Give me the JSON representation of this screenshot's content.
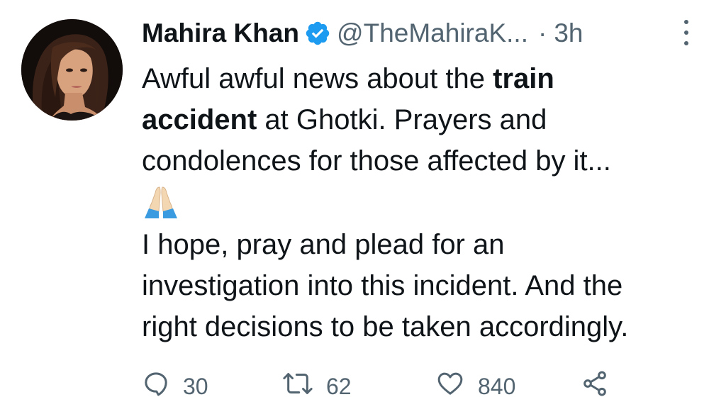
{
  "author": {
    "name": "Mahira Khan",
    "handle": "@TheMahiraK...",
    "separator": "·",
    "time": "3h"
  },
  "tweet": {
    "line1_pre": "Awful awful news about the ",
    "line1_bold": "train",
    "line2_bold": "accident",
    "line2_post": " at Ghotki. Prayers and",
    "line3": "condolences for those affected by it...",
    "line4": "I hope, pray and plead for an",
    "line5": "investigation into this incident. And the",
    "line6": "right decisions to be taken accordingly."
  },
  "actions": {
    "replies": "30",
    "retweets": "62",
    "likes": "840"
  },
  "icons": {
    "verified": "verified-badge-icon",
    "more": "more-options-icon",
    "emoji": "folded-hands-emoji",
    "reply": "reply-icon",
    "retweet": "retweet-icon",
    "like": "heart-icon",
    "share": "share-icon"
  },
  "colors": {
    "text": "#0f1419",
    "secondary": "#536471",
    "verified_blue": "#1d9bf0"
  }
}
